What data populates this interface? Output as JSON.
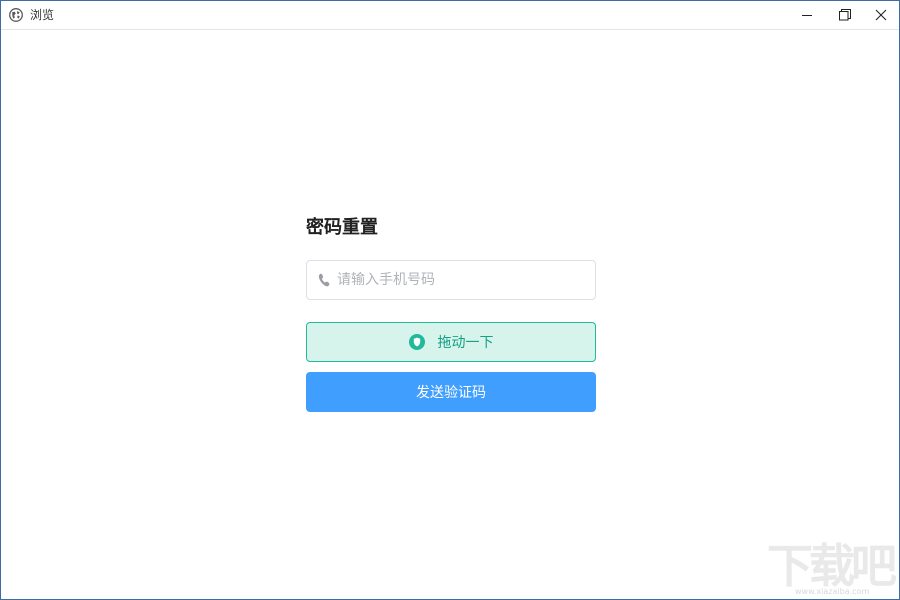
{
  "window": {
    "title": "浏览",
    "app_icon": "globe-icon",
    "controls": {
      "minimize_icon": "minimize-icon",
      "maximize_icon": "restore-icon",
      "close_icon": "close-icon"
    }
  },
  "form": {
    "heading": "密码重置",
    "phone": {
      "icon": "phone-icon",
      "placeholder": "请输入手机号码",
      "value": ""
    },
    "slider": {
      "icon": "shield-icon",
      "label": "拖动一下"
    },
    "send_button_label": "发送验证码"
  },
  "watermark": {
    "text": "下载吧",
    "sub": "www.xiazaiba.com"
  },
  "colors": {
    "accent": "#409eff",
    "verify_border": "#1fb99c",
    "verify_bg": "#d6f3ec",
    "verify_text": "#16a085",
    "window_border": "#3b6ea5"
  }
}
